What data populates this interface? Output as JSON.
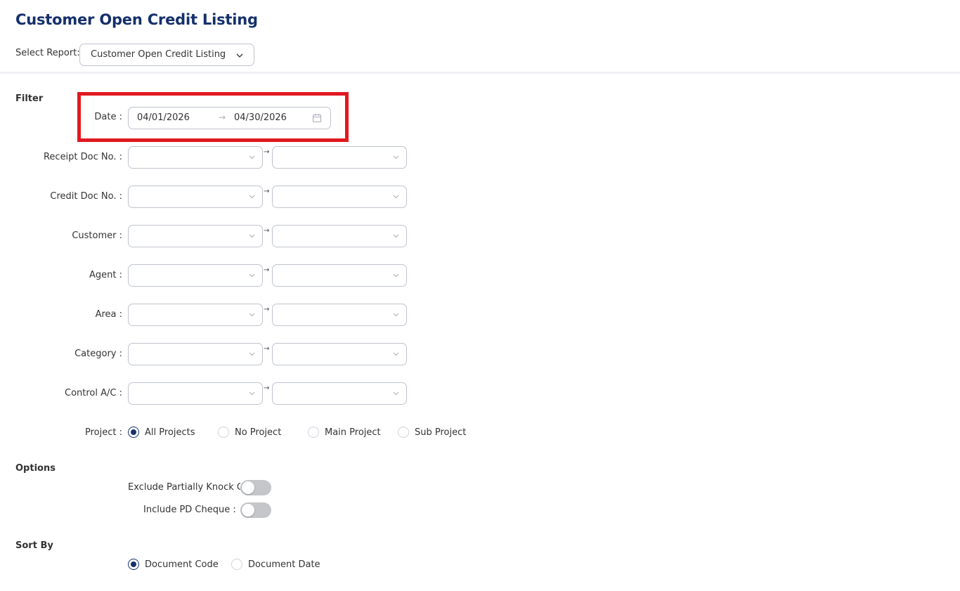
{
  "page": {
    "title": "Customer Open Credit Listing"
  },
  "report": {
    "label": "Select Report:",
    "selected": "Customer Open Credit Listing"
  },
  "filter": {
    "title": "Filter",
    "date": {
      "label": "Date :",
      "start": "04/01/2026",
      "end": "04/30/2026"
    },
    "ranges": [
      {
        "label": "Receipt Doc No. :"
      },
      {
        "label": "Credit Doc No. :"
      },
      {
        "label": "Customer :"
      },
      {
        "label": "Agent :"
      },
      {
        "label": "Area :"
      },
      {
        "label": "Category :"
      },
      {
        "label": "Control A/C :"
      }
    ],
    "project": {
      "label": "Project :",
      "options": [
        "All Projects",
        "No Project",
        "Main Project",
        "Sub Project"
      ],
      "selected": "All Projects"
    }
  },
  "options": {
    "title": "Options",
    "toggles": [
      {
        "label": "Exclude Partially Knock O",
        "on": false
      },
      {
        "label": "Include PD Cheque :",
        "on": false
      }
    ]
  },
  "sort": {
    "title": "Sort By",
    "options": [
      "Document Code",
      "Document Date"
    ],
    "selected": "Document Code"
  },
  "colors": {
    "title": "#15306b",
    "highlight": "#e0191f",
    "toggle_off": "#c4c6c9"
  }
}
